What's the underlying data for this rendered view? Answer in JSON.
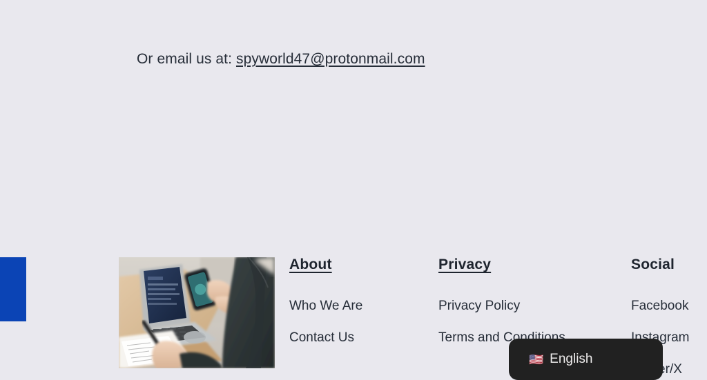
{
  "theme": {
    "background": "#e9e8ee",
    "text": "#262d38",
    "heading": "#1e242e",
    "accent_blue": "#0b44b5",
    "widget_background": "#212121",
    "widget_text": "#eceaea"
  },
  "contact": {
    "label": "Or email us at:",
    "email": "spyworld47@protonmail.com"
  },
  "decoration": {
    "blue_block_name": "blue-accent-block",
    "photo_alt": "Person at desk using a laptop and smartphone while taking notes"
  },
  "footer": {
    "columns": [
      {
        "heading": "About",
        "underlined": true,
        "links": [
          "Who We Are",
          "Contact Us"
        ]
      },
      {
        "heading": "Privacy",
        "underlined": true,
        "links": [
          "Privacy Policy",
          "Terms and Conditions"
        ]
      },
      {
        "heading": "Social",
        "underlined": false,
        "links": [
          "Facebook",
          "Instagram",
          "Twitter/X"
        ]
      }
    ]
  },
  "language_selector": {
    "flag": "🇺🇸",
    "label": "English"
  }
}
